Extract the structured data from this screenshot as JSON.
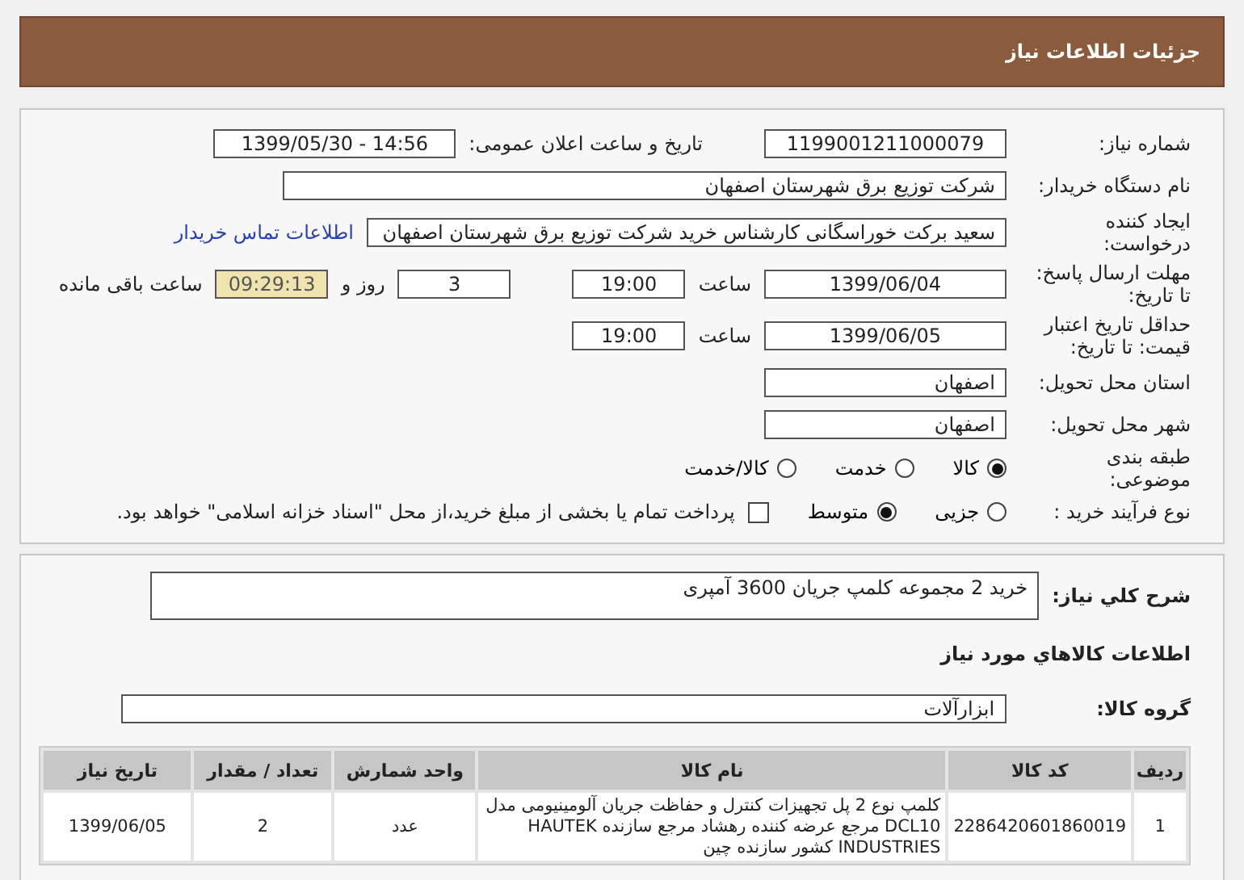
{
  "header": {
    "title": "جزئیات اطلاعات نیاز"
  },
  "need_number": {
    "label": "شماره نیاز:",
    "value": "1199001211000079"
  },
  "announce": {
    "label": "تاریخ و ساعت اعلان عمومی:",
    "value": "1399/05/30 - 14:56"
  },
  "buyer": {
    "label": "نام دستگاه خریدار:",
    "value": "شرکت توزیع برق شهرستان اصفهان"
  },
  "creator": {
    "label": "ایجاد کننده درخواست:",
    "value": "سعید برکت خوراسگانی کارشناس خرید شرکت توزیع برق شهرستان اصفهان",
    "link": "اطلاعات تماس خریدار"
  },
  "deadline": {
    "label": "مهلت ارسال پاسخ: تا تاریخ:",
    "date": "1399/06/04",
    "time_label": "ساعت",
    "time": "19:00",
    "days": "3",
    "days_label": "روز و",
    "remaining": "09:29:13",
    "remaining_label": "ساعت باقی مانده"
  },
  "validity": {
    "label": "حداقل تاریخ اعتبار قیمت: تا تاریخ:",
    "date": "1399/06/05",
    "time_label": "ساعت",
    "time": "19:00"
  },
  "province": {
    "label": "استان محل تحویل:",
    "value": "اصفهان"
  },
  "city": {
    "label": "شهر محل تحویل:",
    "value": "اصفهان"
  },
  "category": {
    "label": "طبقه بندی موضوعی:",
    "options": [
      {
        "label": "کالا",
        "selected": true
      },
      {
        "label": "خدمت",
        "selected": false
      },
      {
        "label": "کالا/خدمت",
        "selected": false
      }
    ]
  },
  "process": {
    "label": "نوع فرآیند خرید :",
    "options": [
      {
        "label": "جزیی",
        "selected": false
      },
      {
        "label": "متوسط",
        "selected": true
      }
    ],
    "payment": {
      "checked": false,
      "label": "پرداخت تمام یا بخشی از مبلغ خرید،از محل \"اسناد خزانه اسلامی\" خواهد بود."
    }
  },
  "summary": {
    "label": "شرح کلي نياز:",
    "value": "خرید 2 مجموعه کلمپ جریان 3600 آمپری"
  },
  "goods_heading": "اطلاعات کالاهاي مورد نياز",
  "group": {
    "label": "گروه کالا:",
    "value": "ابزارآلات"
  },
  "table": {
    "columns": [
      "ردیف",
      "کد کالا",
      "نام کالا",
      "واحد شمارش",
      "تعداد / مقدار",
      "تاریخ نیاز"
    ],
    "rows": [
      [
        "1",
        "2286420601860019",
        "کلمپ نوع 2 پل تجهیزات کنترل و حفاظت جریان آلومینیومی مدل DCL10 مرجع عرضه کننده رهشاد مرجع سازنده HAUTEK INDUSTRIES کشور سازنده چین",
        "عدد",
        "2",
        "1399/06/05"
      ]
    ]
  }
}
